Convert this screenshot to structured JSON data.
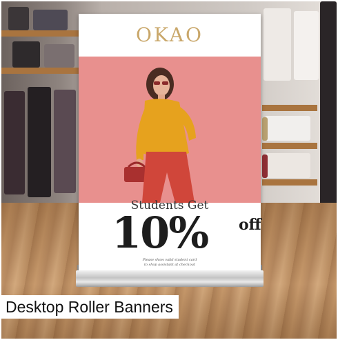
{
  "product": {
    "title": "Desktop Roller Banners"
  },
  "banner": {
    "brand": "OKAO",
    "headline": "Students Get",
    "offer_value": "10%",
    "offer_suffix": "off",
    "fine_print_line1": "Please show valid student card",
    "fine_print_line2": "to shop assistant at checkout"
  }
}
